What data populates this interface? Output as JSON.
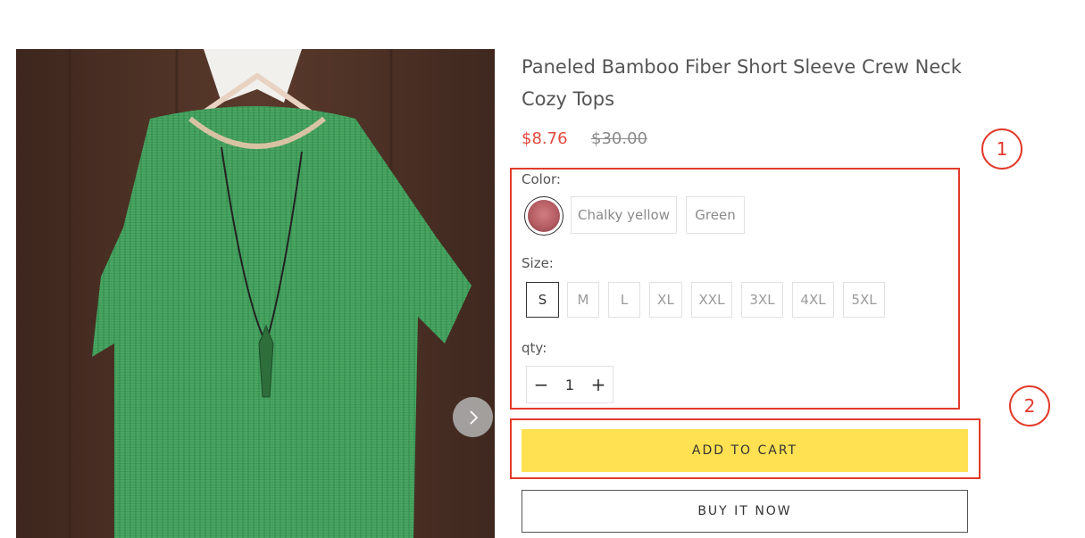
{
  "product": {
    "title": "Paneled Bamboo Fiber Short Sleeve Crew Neck Cozy Tops",
    "price_sale": "$8.76",
    "price_compare": "$30.00",
    "image_icon": "product-photo-green-top"
  },
  "gallery": {
    "next_icon": "chevron-right-icon"
  },
  "color": {
    "label": "Color:",
    "options": [
      "Chalky yellow",
      "Green"
    ]
  },
  "size": {
    "label": "Size:",
    "options": [
      "S",
      "M",
      "L",
      "XL",
      "XXL",
      "3XL",
      "4XL",
      "5XL"
    ],
    "selected": "S"
  },
  "qty": {
    "label": "qty:",
    "minus": "−",
    "value": "1",
    "plus": "+"
  },
  "buttons": {
    "add_to_cart": "ADD TO CART",
    "buy_now": "BUY IT NOW"
  },
  "annotations": {
    "marker_1": "1",
    "marker_2": "2"
  },
  "colors": {
    "sale_price": "#e2493e",
    "add_to_cart_bg": "#ffe152",
    "annotation": "#e23a2a"
  }
}
